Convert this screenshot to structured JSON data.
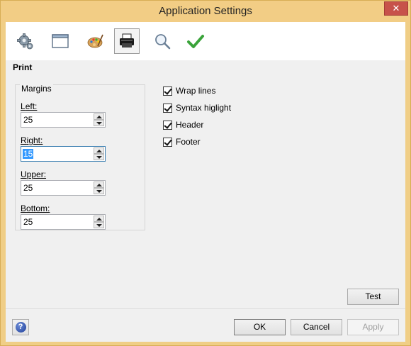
{
  "window": {
    "title": "Application Settings",
    "close_glyph": "✕"
  },
  "toolbar": {
    "buttons": [
      {
        "icon": "gear-icon",
        "name": "general"
      },
      {
        "icon": "window-icon",
        "name": "display"
      },
      {
        "icon": "palette-icon",
        "name": "colors"
      },
      {
        "icon": "printer-icon",
        "name": "print",
        "selected": true
      },
      {
        "icon": "magnifier-icon",
        "name": "search"
      },
      {
        "icon": "checkmark-icon",
        "name": "spelling"
      }
    ]
  },
  "section": {
    "title": "Print"
  },
  "margins": {
    "legend": "Margins",
    "left": {
      "label_u": "L",
      "label_rest": "eft:",
      "value": "25"
    },
    "right": {
      "label_u": "R",
      "label_rest": "ight:",
      "value": "15"
    },
    "upper": {
      "label_u": "U",
      "label_rest": "pper:",
      "value": "25"
    },
    "bottom": {
      "label_u": "B",
      "label_rest": "ottom:",
      "value": "25"
    }
  },
  "options": [
    {
      "label": "Wrap lines",
      "checked": true
    },
    {
      "label": "Syntax higlight",
      "checked": true
    },
    {
      "label": "Header",
      "checked": true
    },
    {
      "label": "Footer",
      "checked": true
    }
  ],
  "buttons": {
    "test": "Test",
    "ok": "OK",
    "cancel": "Cancel",
    "apply": "Apply",
    "help_glyph": "?"
  },
  "colors": {
    "title_bar": "#f2cd85",
    "close_button": "#c7524a",
    "selection": "#3399ff"
  }
}
